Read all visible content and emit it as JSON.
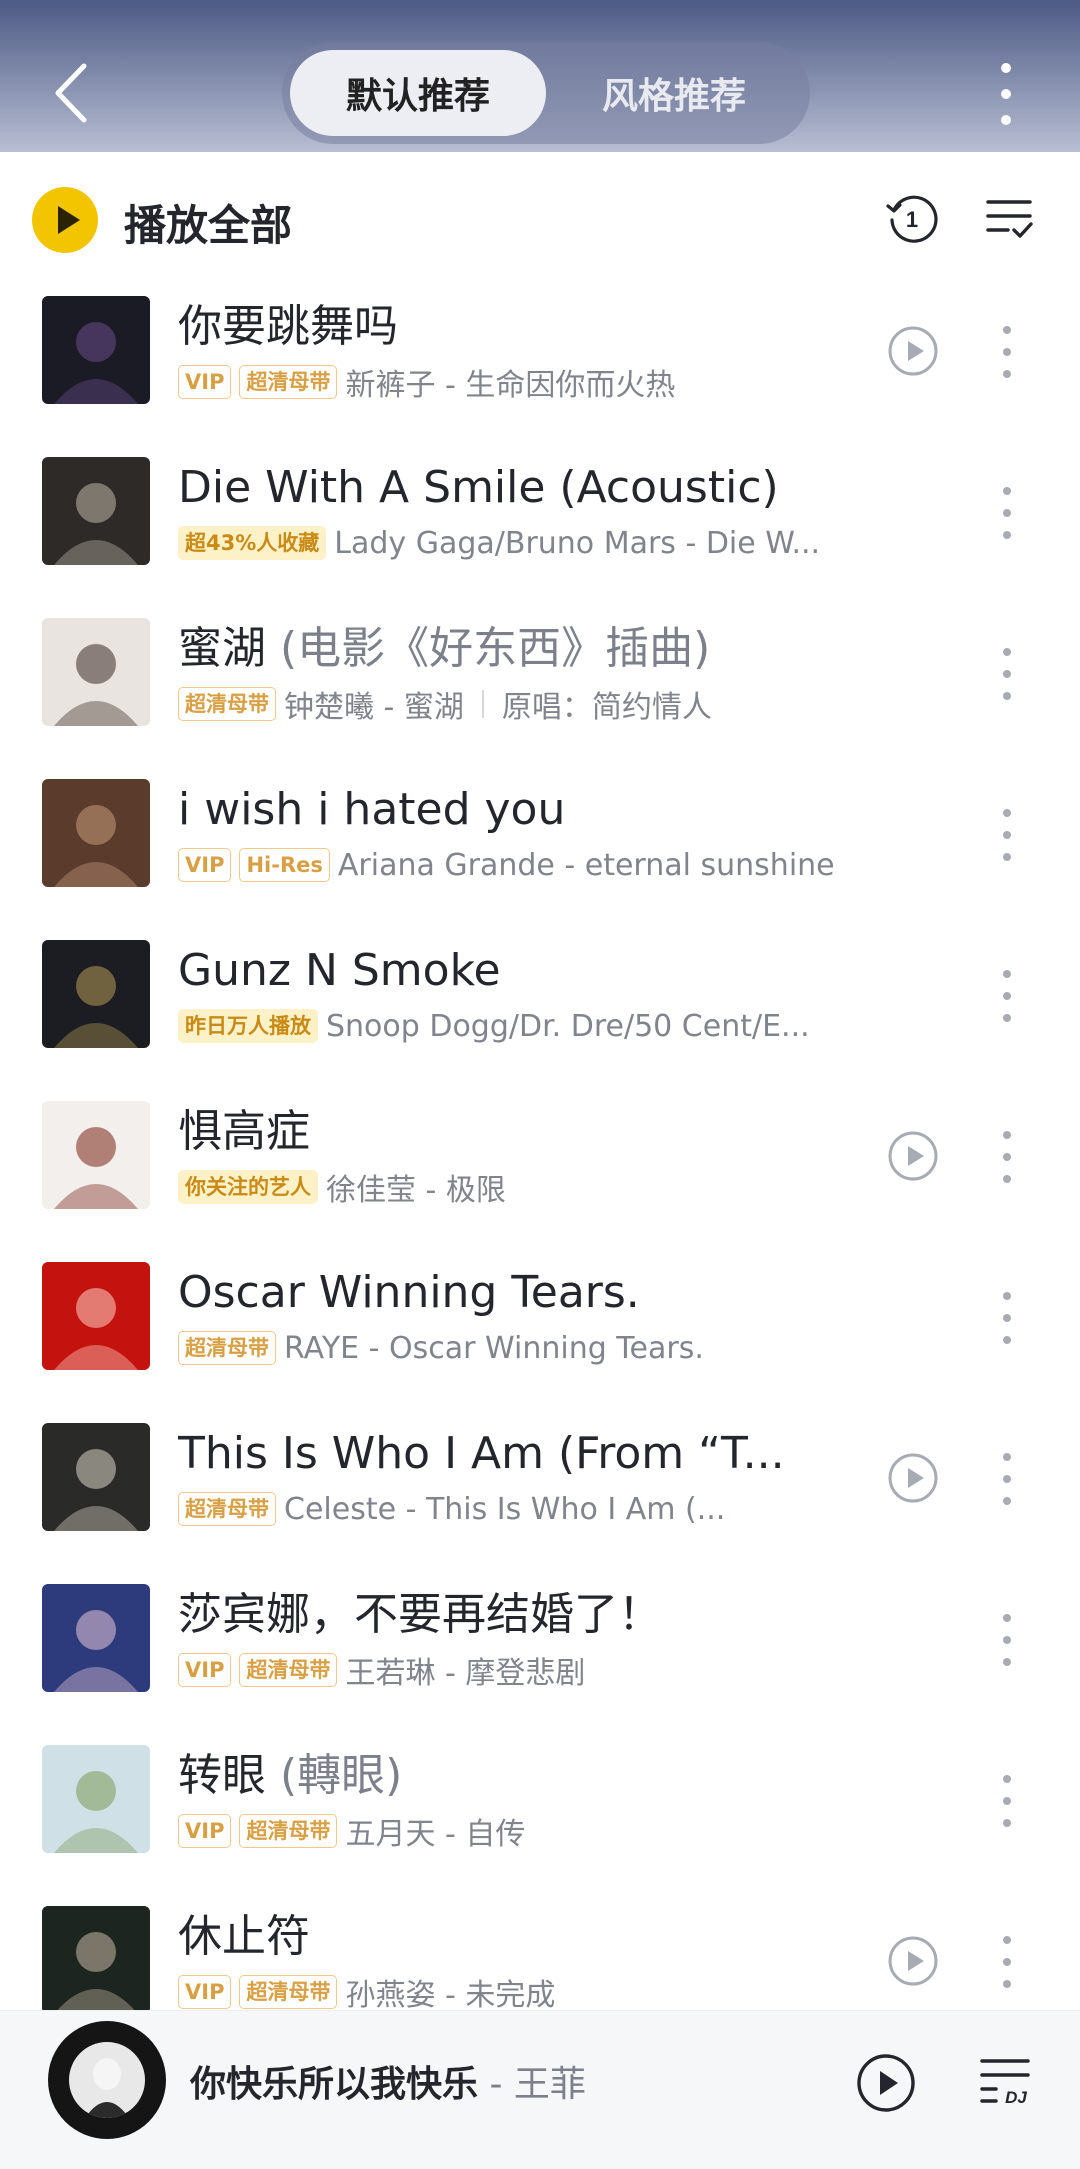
{
  "header": {
    "tabs": [
      {
        "label": "默认推荐",
        "active": true
      },
      {
        "label": "风格推荐",
        "active": false
      }
    ]
  },
  "play_all": {
    "label": "播放全部",
    "history_count": "1"
  },
  "songs": [
    {
      "title": "你要跳舞吗",
      "title_extra": "",
      "tags": [
        "VIP",
        "超清母带"
      ],
      "meta": "新裤子 - 生命因你而火热",
      "meta_extra": "",
      "has_mv": true,
      "cover": {
        "bg": "#1b1b26",
        "accent": "#6a4d8c"
      }
    },
    {
      "title": "Die With A Smile (Acoustic)",
      "title_extra": "",
      "tags": [
        "超43%人收藏"
      ],
      "meta": "Lady Gaga/Bruno Mars - Die W...",
      "meta_extra": "",
      "has_mv": false,
      "cover": {
        "bg": "#2e2a28",
        "accent": "#bfb7a8"
      }
    },
    {
      "title": "蜜湖",
      "title_extra": " (电影《好东西》插曲)",
      "tags": [
        "超清母带"
      ],
      "meta": "钟楚曦 - 蜜湖",
      "meta_extra": "原唱：简约情人",
      "has_mv": false,
      "cover": {
        "bg": "#e9e4df",
        "accent": "#3a2a24"
      }
    },
    {
      "title": "i wish i hated you",
      "title_extra": "",
      "tags": [
        "VIP",
        "Hi-Res"
      ],
      "meta": "Ariana Grande - eternal sunshine",
      "meta_extra": "",
      "has_mv": false,
      "cover": {
        "bg": "#5a3b2c",
        "accent": "#c99a7c"
      }
    },
    {
      "title": "Gunz N Smoke",
      "title_extra": "",
      "tags": [
        "昨日万人播放"
      ],
      "meta": "Snoop Dogg/Dr. Dre/50 Cent/E...",
      "meta_extra": "",
      "has_mv": false,
      "cover": {
        "bg": "#1c1d22",
        "accent": "#b79b56"
      }
    },
    {
      "title": "惧高症",
      "title_extra": "",
      "tags": [
        "你关注的艺人"
      ],
      "meta": "徐佳莹 - 极限",
      "meta_extra": "",
      "has_mv": true,
      "cover": {
        "bg": "#f2efec",
        "accent": "#7a2418"
      }
    },
    {
      "title": "Oscar Winning Tears.",
      "title_extra": "",
      "tags": [
        "超清母带"
      ],
      "meta": "RAYE - Oscar Winning Tears.",
      "meta_extra": "",
      "has_mv": false,
      "cover": {
        "bg": "#c4120f",
        "accent": "#ffd2c4"
      }
    },
    {
      "title": "This Is Who I Am (From “T...",
      "title_extra": "",
      "tags": [
        "超清母带"
      ],
      "meta": "Celeste - This Is Who I Am (...",
      "meta_extra": "",
      "has_mv": true,
      "cover": {
        "bg": "#2a2a28",
        "accent": "#d9d4c6"
      }
    },
    {
      "title": "莎宾娜，不要再结婚了！",
      "title_extra": "",
      "tags": [
        "VIP",
        "超清母带"
      ],
      "meta": "王若琳 - 摩登悲剧",
      "meta_extra": "",
      "has_mv": false,
      "cover": {
        "bg": "#2d3b7c",
        "accent": "#e8c7d8"
      }
    },
    {
      "title": "转眼",
      "title_extra": " (轉眼)",
      "tags": [
        "VIP",
        "超清母带"
      ],
      "meta": "五月天 - 自传",
      "meta_extra": "",
      "has_mv": false,
      "cover": {
        "bg": "#cfe0e6",
        "accent": "#7f9a5a"
      }
    },
    {
      "title": "休止符",
      "title_extra": "",
      "tags": [
        "VIP",
        "超清母带"
      ],
      "meta": "孙燕姿 - 未完成",
      "meta_extra": "",
      "has_mv": true,
      "cover": {
        "bg": "#1d2521",
        "accent": "#c8b9a6"
      }
    }
  ],
  "filled_tags": [
    "超43%人收藏",
    "昨日万人播放",
    "你关注的艺人"
  ],
  "mini_player": {
    "title": "你快乐所以我快乐",
    "artist": "王菲",
    "separator": " - "
  },
  "colors": {
    "accent_yellow": "#f3c500",
    "tag_text": "#d8a044",
    "header_top": "#4e5a86"
  }
}
